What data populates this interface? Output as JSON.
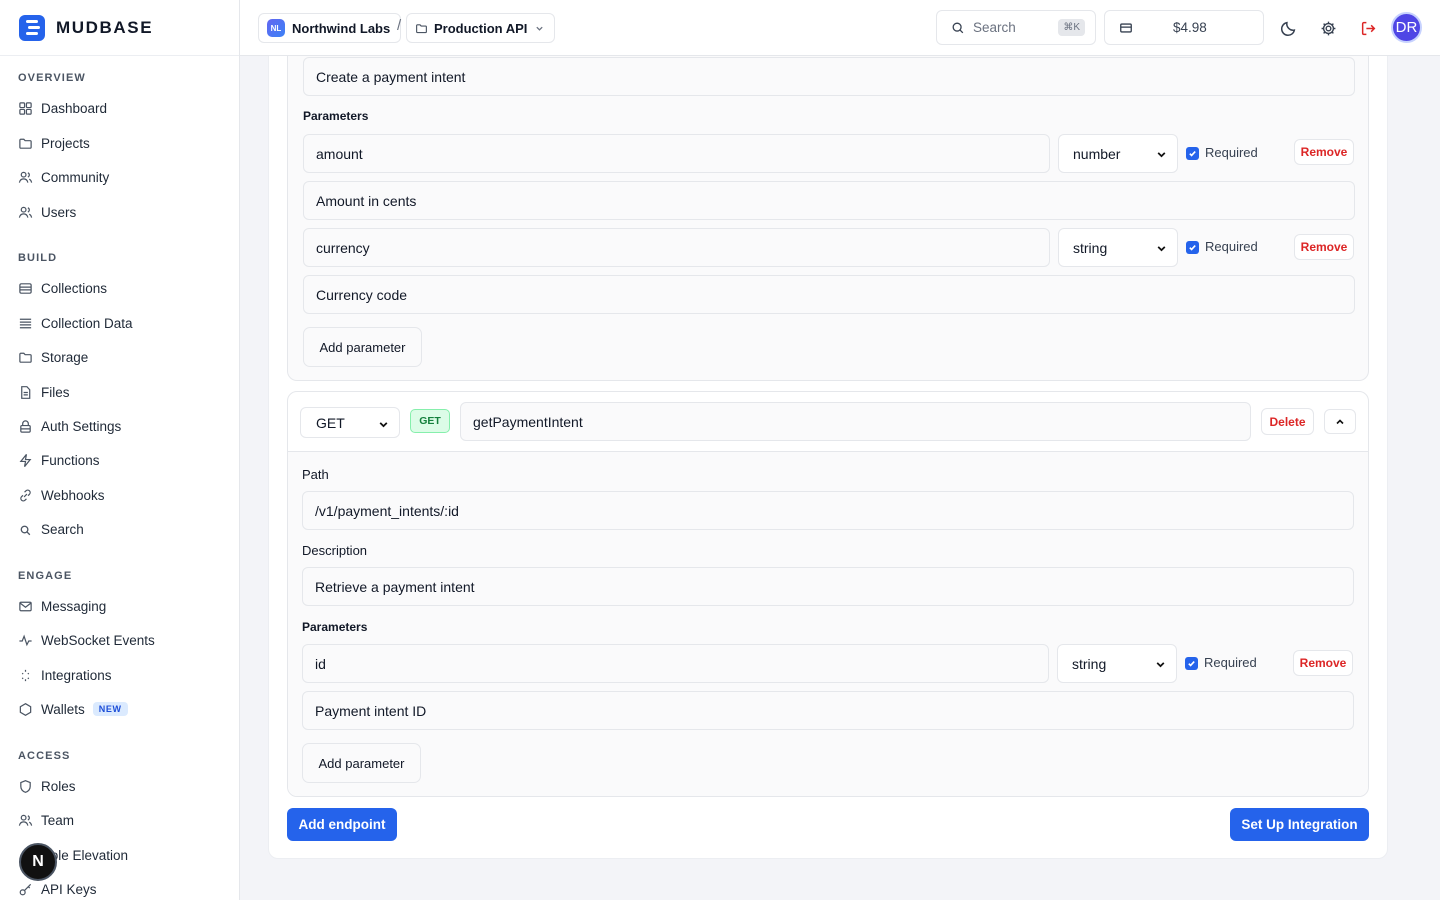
{
  "brand": {
    "name": "MUDBASE"
  },
  "nav": {
    "overview": {
      "title": "OVERVIEW",
      "items": [
        "Dashboard",
        "Projects",
        "Community",
        "Users"
      ]
    },
    "build": {
      "title": "BUILD",
      "items": [
        "Collections",
        "Collection Data",
        "Storage",
        "Files",
        "Auth Settings",
        "Functions",
        "Webhooks",
        "Search"
      ]
    },
    "engage": {
      "title": "ENGAGE",
      "items": [
        "Messaging",
        "WebSocket Events",
        "Integrations",
        "Wallets"
      ],
      "wallets_badge": "NEW"
    },
    "access": {
      "title": "ACCESS",
      "items": [
        "Roles",
        "Team",
        "Role Elevation",
        "API Keys"
      ]
    }
  },
  "floating_button": {
    "label": "N"
  },
  "topbar": {
    "org_initials": "NL",
    "org_name": "Northwind Labs",
    "separator": "/",
    "project_name": "Production API",
    "search_placeholder": "Search",
    "search_shortcut": "⌘K",
    "credits": "$4.98",
    "user_initials": "DR"
  },
  "endpoint1": {
    "description": "Create a payment intent",
    "parameters_label": "Parameters",
    "params": [
      {
        "name": "amount",
        "type": "number",
        "required_label": "Required",
        "remove_label": "Remove",
        "description": "Amount in cents"
      },
      {
        "name": "currency",
        "type": "string",
        "required_label": "Required",
        "remove_label": "Remove",
        "description": "Currency code"
      }
    ],
    "add_parameter_label": "Add parameter"
  },
  "endpoint2": {
    "method": "GET",
    "method_tag": "GET",
    "name": "getPaymentIntent",
    "delete_label": "Delete",
    "path_label": "Path",
    "path": "/v1/payment_intents/:id",
    "description_label": "Description",
    "description": "Retrieve a payment intent",
    "parameters_label": "Parameters",
    "params": [
      {
        "name": "id",
        "type": "string",
        "required_label": "Required",
        "remove_label": "Remove",
        "description": "Payment intent ID"
      }
    ],
    "add_parameter_label": "Add parameter"
  },
  "actions": {
    "add_endpoint": "Add endpoint",
    "setup_integration": "Set Up Integration"
  },
  "colors": {
    "accent": "#2563eb",
    "danger": "#dc2626",
    "get_badge": "#15803d"
  }
}
